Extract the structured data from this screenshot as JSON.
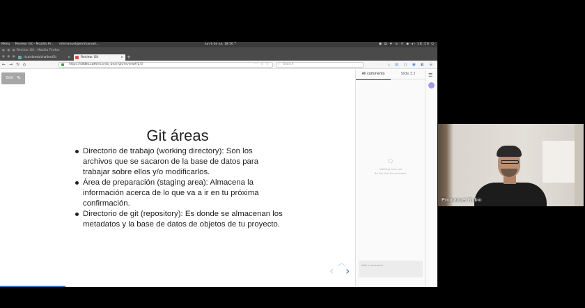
{
  "os_panel": {
    "menu": "Menu",
    "task1": "Review: Git - Mozilla Fir...",
    "task2": "emmanuel@emmanuel...",
    "clock": "lun 6 de jul, 18:56",
    "clock_extra": "❜❜",
    "tray": "▣ ▤ ♦ ☏ ⚟ ◉ ◂) 18:56 ⏻"
  },
  "window": {
    "title": "Review: Git - Mozilla Firefox"
  },
  "tabs": [
    {
      "label": "ricardomb/challenGit"
    },
    {
      "label": "Review: Git"
    }
  ],
  "navbar": {
    "url_scheme": "https://",
    "url_domain": "slides.com",
    "url_path": "/ricardo_bear/git/review#/2/3",
    "url_more": "··· ☆ ☆",
    "search_placeholder": "Search"
  },
  "app": {
    "edit_label": "Edit",
    "slide": {
      "title": "Git áreas",
      "bullets": [
        "Directorio de trabajo (working directory): Son los archivos que se sacaron de la base de datos para trabajar sobre ellos y/o modificarlos.",
        "Área de preparación (staging area): Almacena la información acerca de lo que va a ir en tu próxima confirmación.",
        "Directorio de git (repository): Es donde se almacenan los metadatos y la base de datos de objetos de tu proyecto."
      ]
    },
    "progress_fraction": 0.15,
    "comments": {
      "tab_all": "All comments",
      "tab_slide": "Slide 3.3",
      "empty_line1": "Nothing here yet",
      "empty_line2": "Be the first to comment.",
      "input_placeholder": "Add a comment..."
    }
  },
  "webcam": {
    "participant_name": "Emmanuel Rubio"
  },
  "colors": {
    "accent": "#3474b4",
    "avatar": "#a59ae6"
  }
}
